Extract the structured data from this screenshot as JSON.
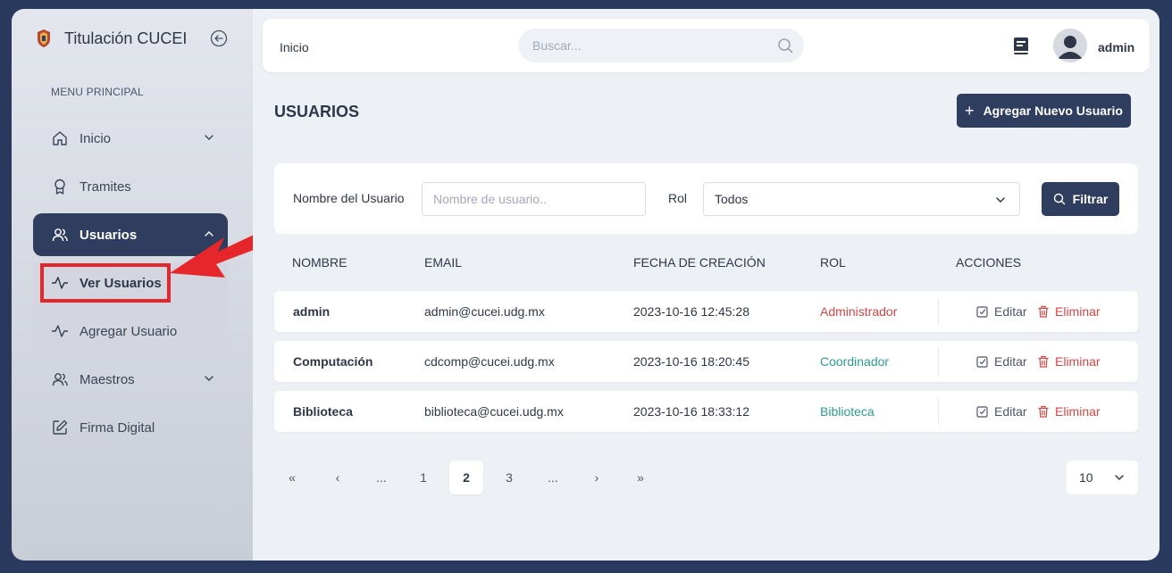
{
  "sidebar": {
    "title": "Titulación CUCEI",
    "menu_label": "MENU PRINCIPAL",
    "items": [
      {
        "label": "Inicio"
      },
      {
        "label": "Tramites"
      },
      {
        "label": "Usuarios"
      },
      {
        "label": "Maestros"
      },
      {
        "label": "Firma Digital"
      }
    ],
    "submenu": [
      {
        "label": "Ver Usuarios"
      },
      {
        "label": "Agregar Usuario"
      }
    ]
  },
  "topbar": {
    "breadcrumb": "Inicio",
    "search_placeholder": "Buscar...",
    "username": "admin"
  },
  "page": {
    "title": "USUARIOS",
    "add_button": "Agregar Nuevo Usuario"
  },
  "filters": {
    "name_label": "Nombre del Usuario",
    "name_placeholder": "Nombre de usuario..",
    "role_label": "Rol",
    "role_value": "Todos",
    "filter_button": "Filtrar"
  },
  "table": {
    "headers": [
      "NOMBRE",
      "EMAIL",
      "FECHA DE CREACIÓN",
      "ROL",
      "ACCIONES"
    ],
    "rows": [
      {
        "nombre": "admin",
        "email": "admin@cucei.udg.mx",
        "fecha": "2023-10-16 12:45:28",
        "rol": "Administrador",
        "rol_color": "#d64545"
      },
      {
        "nombre": "Computación",
        "email": "cdcomp@cucei.udg.mx",
        "fecha": "2023-10-16 18:20:45",
        "rol": "Coordinador",
        "rol_color": "#2a9d8f"
      },
      {
        "nombre": "Biblioteca",
        "email": "biblioteca@cucei.udg.mx",
        "fecha": "2023-10-16 18:33:12",
        "rol": "Biblioteca",
        "rol_color": "#2a9d8f"
      }
    ],
    "edit_label": "Editar",
    "delete_label": "Eliminar"
  },
  "pagination": {
    "first": "«",
    "prev": "‹",
    "ellipsis_left": "...",
    "pages": [
      "1",
      "2",
      "3"
    ],
    "current": "2",
    "ellipsis_right": "...",
    "next": "›",
    "last": "»",
    "per_page": "10"
  },
  "colors": {
    "primary": "#2f3d5f",
    "danger": "#d64545",
    "success": "#2a9d8f",
    "highlight": "#e5262b"
  }
}
